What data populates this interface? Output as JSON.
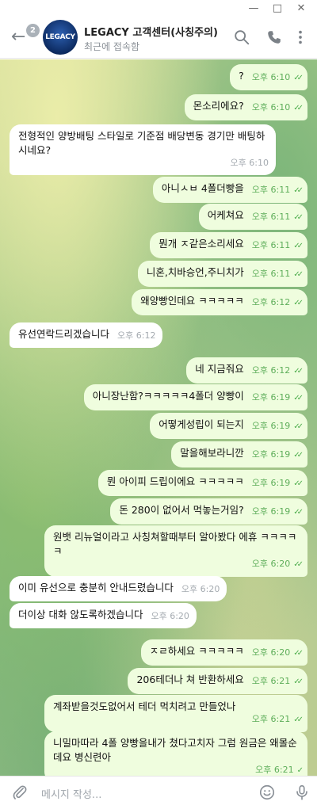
{
  "window": {
    "minimize_icon": "minimize-icon",
    "maximize_icon": "maximize-icon",
    "close_icon": "close-icon"
  },
  "header": {
    "back_icon": "back-arrow-icon",
    "unread_badge": "2",
    "avatar_text": "LEGACY",
    "title": "LEGACY 고객센터(사칭주의)",
    "status": "최근에 접속함",
    "search_icon": "search-icon",
    "call_icon": "phone-icon",
    "menu_icon": "more-vertical-icon"
  },
  "messages": [
    {
      "dir": "out",
      "text": "?",
      "time": "오후 6:10"
    },
    {
      "dir": "out",
      "text": "몬소리에요?",
      "time": "오후 6:10"
    },
    {
      "dir": "in",
      "text": "전형적인 양방배팅 스타일로 기준점 배당변동 경기만 배팅하시네요?",
      "time": "오후 6:10"
    },
    {
      "dir": "out",
      "text": "아니ㅅㅂ 4폴더빵을",
      "time": "오후 6:11"
    },
    {
      "dir": "out",
      "text": "어케쳐요",
      "time": "오후 6:11"
    },
    {
      "dir": "out",
      "text": "뭔개 ㅈ같은소리세요",
      "time": "오후 6:11"
    },
    {
      "dir": "out",
      "text": "니혼,치바승언,주니치가",
      "time": "오후 6:11"
    },
    {
      "dir": "out",
      "text": "왜양빵인데요 ㅋㅋㅋㅋㅋ",
      "time": "오후 6:12"
    },
    {
      "dir": "in",
      "text": "유선연락드리겠습니다",
      "time": "오후 6:12"
    },
    {
      "dir": "out",
      "text": "네 지금줘요",
      "time": "오후 6:12"
    },
    {
      "dir": "out",
      "text": "아니장난함?ㅋㅋㅋㅋㅋ4폴더 양빵이",
      "time": "오후 6:19"
    },
    {
      "dir": "out",
      "text": "어떻게성립이 되는지",
      "time": "오후 6:19"
    },
    {
      "dir": "out",
      "text": "말을해보라니깐",
      "time": "오후 6:19"
    },
    {
      "dir": "out",
      "text": "뭔 아이피 드립이에요 ㅋㅋㅋㅋㅋ",
      "time": "오후 6:19"
    },
    {
      "dir": "out",
      "text": "돈 280이 없어서 먹놓는거임?",
      "time": "오후 6:19"
    },
    {
      "dir": "out",
      "text": "원뱃 리뉴얼이라고 사칭쳐할때부터 알아봤다 에휴 ㅋㅋㅋㅋㅋ",
      "time": "오후 6:20"
    },
    {
      "dir": "in",
      "text": "이미 유선으로 충분히 안내드렸습니다",
      "time": "오후 6:20"
    },
    {
      "dir": "in",
      "text": "더이상 대화 않도록하겠습니다",
      "time": "오후 6:20"
    },
    {
      "dir": "out",
      "text": "ㅈㄹ하세요 ㅋㅋㅋㅋㅋ",
      "time": "오후 6:20"
    },
    {
      "dir": "out",
      "text": "206테더나 쳐 반환하세요",
      "time": "오후 6:21"
    },
    {
      "dir": "out",
      "text": "계좌받을것도없어서 테더 먹치려고 만들었나",
      "time": "오후 6:21"
    },
    {
      "dir": "out",
      "text": "니밀마따라 4폴 양빵을내가 쳤다고치자 그럼 원금은 왜몰순데요 병신련아",
      "time": "오후 6:21"
    }
  ],
  "composer": {
    "attach_icon": "paperclip-icon",
    "placeholder": "메시지 작성...",
    "emoji_icon": "emoji-icon",
    "mic_icon": "microphone-icon"
  },
  "colors": {
    "outgoing_bubble": "#effdde",
    "incoming_bubble": "#ffffff",
    "check_marks": "#4fae4e",
    "header_bg": "#ffffff"
  }
}
